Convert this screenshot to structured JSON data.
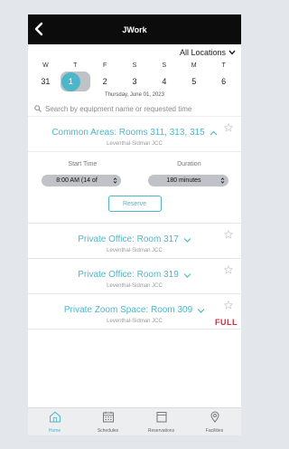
{
  "header": {
    "title": "JWork",
    "back_icon": "chevron-left-icon"
  },
  "location_filter": {
    "value": "All Locations"
  },
  "calendar": {
    "days": [
      {
        "name": "W",
        "num": "31"
      },
      {
        "name": "T",
        "num": "1"
      },
      {
        "name": "F",
        "num": "2"
      },
      {
        "name": "S",
        "num": "3"
      },
      {
        "name": "S",
        "num": "4"
      },
      {
        "name": "M",
        "num": "5"
      },
      {
        "name": "T",
        "num": "6"
      }
    ],
    "selected_index": 1,
    "selected_date": "Thursday, June 01, 2023"
  },
  "search": {
    "placeholder": "Search by equipment name or requested time"
  },
  "rooms": [
    {
      "title": "Common Areas: Rooms 311, 313, 315",
      "location": "Leventhal-Sidman JCC",
      "expanded": true,
      "start_time_label": "Start Time",
      "duration_label": "Duration",
      "start_time_value": "8:00 AM (14 of",
      "duration_value": "180 minutes",
      "reserve_label": "Reserve"
    },
    {
      "title": "Private Office: Room 317",
      "location": "Leventhal-Sidman JCC"
    },
    {
      "title": "Private Office: Room 319",
      "location": "Leventhal-Sidman JCC"
    },
    {
      "title": "Private Zoom Space: Room 309",
      "location": "Leventhal-Sidman JCC",
      "status": "FULL"
    }
  ],
  "tabs": [
    {
      "label": "Home",
      "icon": "home-icon",
      "active": true
    },
    {
      "label": "Schedules",
      "icon": "calendar-icon"
    },
    {
      "label": "Reservations",
      "icon": "clipboard-icon"
    },
    {
      "label": "Facilities",
      "icon": "map-pin-icon"
    }
  ],
  "colors": {
    "accent": "#4db7c9",
    "full": "#d9293a",
    "header_bg": "#0c0c0c"
  }
}
